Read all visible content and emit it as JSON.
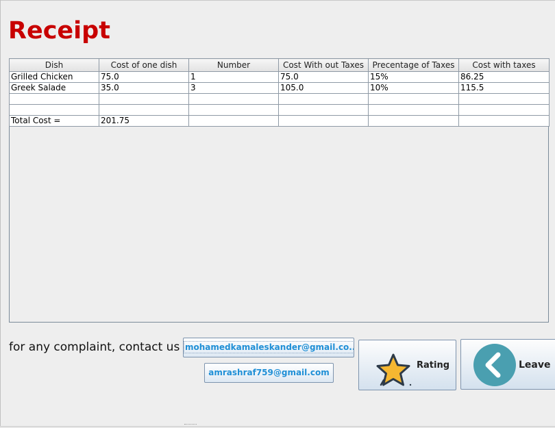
{
  "title": "Receipt",
  "table": {
    "headers": [
      "Dish",
      "Cost of one dish",
      "Number",
      "Cost With out Taxes",
      "Precentage of Taxes",
      "Cost with taxes"
    ],
    "rows": [
      [
        "Grilled Chicken",
        "75.0",
        "1",
        "75.0",
        "15%",
        "86.25"
      ],
      [
        "Greek Salade",
        "35.0",
        "3",
        "105.0",
        "10%",
        "115.5"
      ],
      [
        "",
        "",
        "",
        "",
        "",
        ""
      ],
      [
        "",
        "",
        "",
        "",
        "",
        ""
      ],
      [
        "Total Cost =",
        "201.75",
        "",
        "",
        "",
        ""
      ]
    ]
  },
  "contact": {
    "text": "for any complaint, contact us",
    "email1": "mohamedkamaleskander@gmail.co...",
    "email2": "amrashraf759@gmail.com"
  },
  "buttons": {
    "rating": "Rating",
    "leave": "Leave"
  },
  "icons": {
    "rating": "star-icon",
    "leave": "back-chevron-icon"
  },
  "colors": {
    "title": "#c80000",
    "email_text": "#1f8fd6",
    "star_fill": "#f5b731",
    "leave_circle": "#4a9fb0"
  }
}
